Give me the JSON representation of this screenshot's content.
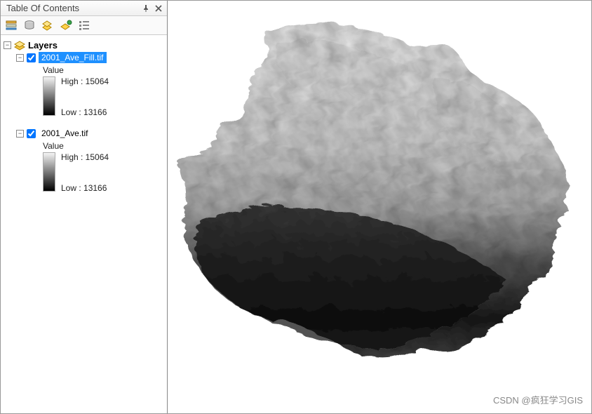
{
  "panel": {
    "title": "Table Of Contents"
  },
  "tree": {
    "root_label": "Layers",
    "layers": [
      {
        "name": "2001_Ave_Fill.tif",
        "checked": true,
        "selected": true,
        "value_label": "Value",
        "high_label": "High : 15064",
        "low_label": "Low : 13166"
      },
      {
        "name": "2001_Ave.tif",
        "checked": true,
        "selected": false,
        "value_label": "Value",
        "high_label": "High : 15064",
        "low_label": "Low : 13166"
      }
    ]
  },
  "watermark": "CSDN @疯狂学习GIS"
}
